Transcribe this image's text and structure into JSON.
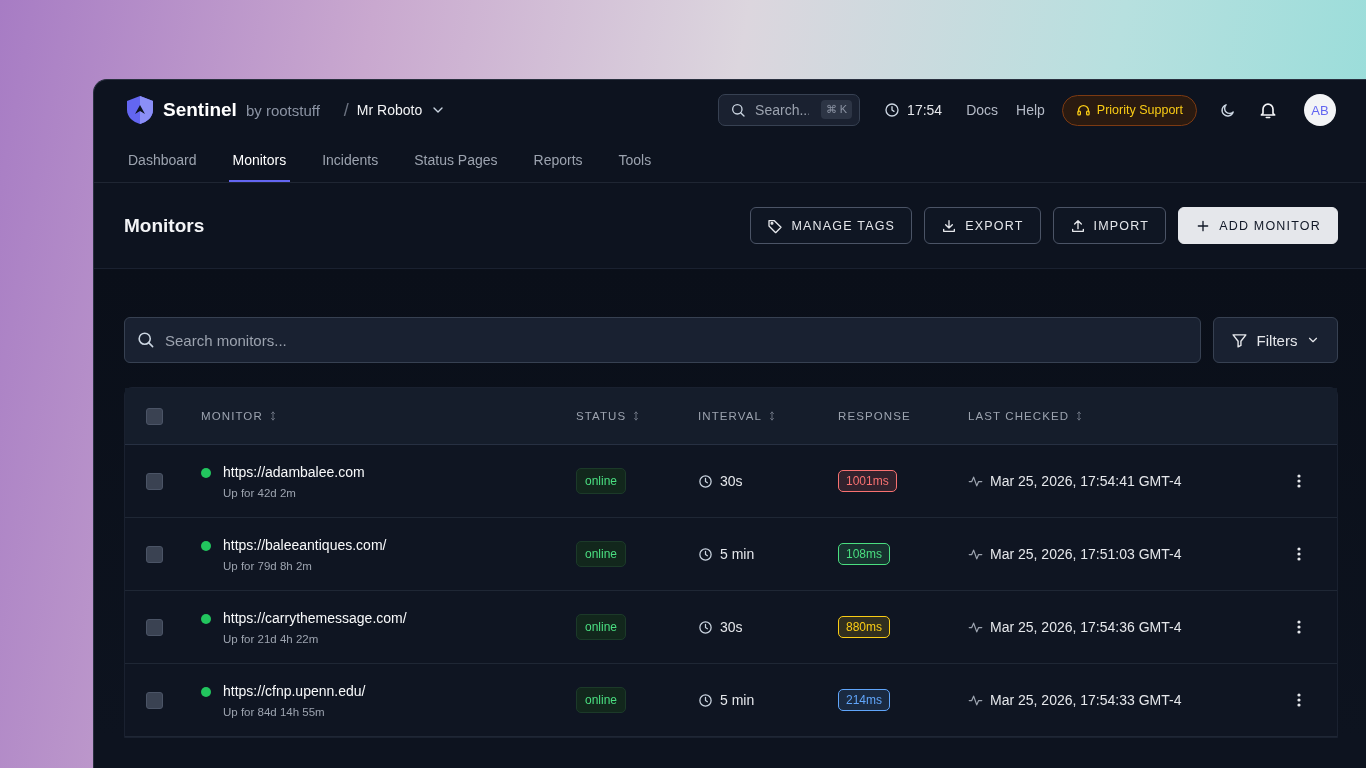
{
  "brand": {
    "name": "Sentinel",
    "byline": "by rootstuff"
  },
  "workspace": {
    "separator": "/",
    "name": "Mr Roboto"
  },
  "search": {
    "placeholder": "Search...",
    "shortcut": "⌘ K"
  },
  "clock": "17:54",
  "links": [
    "Docs",
    "Help"
  ],
  "support": "Priority Support",
  "user": {
    "initials": "AB"
  },
  "tabs": [
    {
      "label": "Dashboard",
      "selected": false
    },
    {
      "label": "Monitors",
      "selected": true
    },
    {
      "label": "Incidents",
      "selected": false
    },
    {
      "label": "Status Pages",
      "selected": false
    },
    {
      "label": "Reports",
      "selected": false
    },
    {
      "label": "Tools",
      "selected": false
    }
  ],
  "page": {
    "title": "Monitors",
    "actions": [
      {
        "label": "MANAGE TAGS",
        "kind": "tag",
        "primary": false
      },
      {
        "label": "EXPORT",
        "kind": "download",
        "primary": false
      },
      {
        "label": "IMPORT",
        "kind": "upload",
        "primary": false
      },
      {
        "label": "ADD MONITOR",
        "kind": "plus",
        "primary": true
      }
    ]
  },
  "monitor_search": {
    "placeholder": "Search monitors..."
  },
  "filters": "Filters",
  "table": {
    "select_all": {
      "checked": false
    },
    "columns": [
      {
        "label": "MONITOR",
        "sortable": true
      },
      {
        "label": "STATUS",
        "sortable": true
      },
      {
        "label": "INTERVAL",
        "sortable": true
      },
      {
        "label": "RESPONSE",
        "sortable": false
      },
      {
        "label": "LAST CHECKED",
        "sortable": true
      }
    ],
    "rows": [
      {
        "checked": false,
        "color": "#22c55e",
        "url": "https://adambalee.com",
        "uptime": "Up for 42d 2m",
        "status": "online",
        "interval": "30s",
        "response": {
          "text": "1001ms",
          "color": "#f87171"
        },
        "last_checked": "Mar 25, 2026, 17:54:41 GMT-4"
      },
      {
        "checked": false,
        "color": "#22c55e",
        "url": "https://baleeantiques.com/",
        "uptime": "Up for 79d 8h 2m",
        "status": "online",
        "interval": "5 min",
        "response": {
          "text": "108ms",
          "color": "#4ade80"
        },
        "last_checked": "Mar 25, 2026, 17:51:03 GMT-4"
      },
      {
        "checked": false,
        "color": "#22c55e",
        "url": "https://carrythemessage.com/",
        "uptime": "Up for 21d 4h 22m",
        "status": "online",
        "interval": "30s",
        "response": {
          "text": "880ms",
          "color": "#facc15"
        },
        "last_checked": "Mar 25, 2026, 17:54:36 GMT-4"
      },
      {
        "checked": false,
        "color": "#22c55e",
        "url": "https://cfnp.upenn.edu/",
        "uptime": "Up for 84d 14h 55m",
        "status": "online",
        "interval": "5 min",
        "response": {
          "text": "214ms",
          "color": "#60a5fa"
        },
        "last_checked": "Mar 25, 2026, 17:54:33 GMT-4"
      }
    ]
  }
}
